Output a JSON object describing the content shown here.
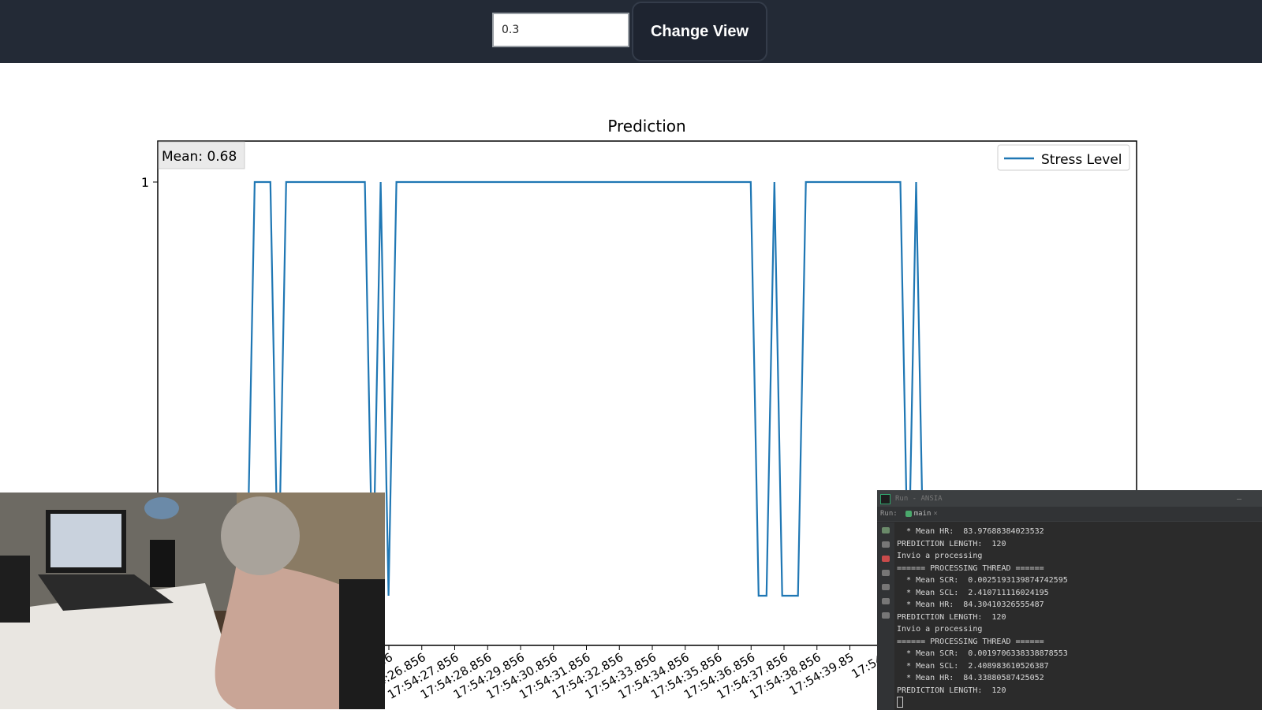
{
  "toolbar": {
    "threshold_value": "0.3",
    "change_view_label": "Change View"
  },
  "chart_data": {
    "type": "line",
    "title": "Prediction",
    "annotation": "Mean: 0.68",
    "legend": {
      "placement": "top-right",
      "entries": [
        "Stress Level"
      ]
    },
    "series": [
      {
        "name": "Stress Level",
        "color": "#1f77b4",
        "x": [
          0.0,
          0.2,
          0.4,
          0.6,
          0.8,
          1.0,
          1.2,
          1.4,
          1.6,
          1.8,
          2.0,
          2.2,
          2.4,
          2.6,
          2.8,
          3.0,
          3.2,
          3.4,
          3.6,
          3.8,
          4.0,
          4.2,
          4.4,
          4.6,
          4.8,
          5.0,
          5.2,
          5.4,
          5.6,
          5.8,
          6.0,
          6.2,
          6.4,
          6.6,
          6.8,
          7.0,
          7.2,
          7.4,
          7.6,
          7.8,
          8.0,
          8.2,
          8.4,
          8.6,
          8.8,
          9.0,
          9.2,
          9.4,
          9.6,
          9.8,
          10.0,
          10.2,
          10.4,
          10.6,
          10.8,
          11.0,
          11.2,
          11.4,
          11.6,
          11.8,
          12.0,
          12.2,
          12.4,
          12.6,
          12.8,
          13.0,
          13.2,
          13.4,
          13.6,
          13.8,
          14.0,
          14.2,
          14.4,
          14.6,
          14.8,
          15.0,
          15.2,
          15.4,
          15.6,
          15.8,
          16.0,
          16.2,
          16.4,
          16.6,
          16.8,
          17.0,
          17.2,
          17.4,
          17.6,
          17.8,
          18.0,
          18.2,
          18.4,
          18.6,
          18.8,
          19.0,
          19.2,
          19.4,
          19.6,
          19.8,
          20.0,
          20.2,
          20.4,
          20.6,
          20.8,
          21.0,
          21.2,
          21.4,
          21.6,
          21.8,
          22.0,
          22.2,
          22.4,
          22.6,
          22.8,
          23.0,
          23.2,
          23.4,
          23.6,
          23.8
        ],
        "y": [
          0,
          0,
          0,
          0,
          0,
          0,
          0,
          0,
          1,
          1,
          1,
          0,
          1,
          1,
          1,
          1,
          1,
          1,
          1,
          1,
          1,
          1,
          1,
          0,
          1,
          0,
          1,
          1,
          1,
          1,
          1,
          1,
          1,
          1,
          1,
          1,
          1,
          1,
          1,
          1,
          1,
          1,
          1,
          1,
          1,
          1,
          1,
          1,
          1,
          1,
          1,
          1,
          1,
          1,
          1,
          1,
          1,
          1,
          1,
          1,
          1,
          1,
          1,
          1,
          1,
          1,
          1,
          1,
          1,
          1,
          1,
          1,
          0,
          0,
          1,
          0,
          0,
          0,
          1,
          1,
          1,
          1,
          1,
          1,
          1,
          1,
          1,
          1,
          1,
          1,
          1,
          0,
          1,
          0,
          0,
          0,
          0,
          0,
          0,
          0,
          0,
          0,
          0,
          0,
          0,
          0,
          0,
          0,
          0,
          0,
          0,
          0,
          0,
          0,
          0,
          0,
          0,
          0,
          0,
          0
        ]
      }
    ],
    "yticks": [
      "1"
    ],
    "xtick_labels": [
      "25.856",
      "17:54:26.856",
      "17:54:27.856",
      "17:54:28.856",
      "17:54:29.856",
      "17:54:30.856",
      "17:54:31.856",
      "17:54:32.856",
      "17:54:33.856",
      "17:54:34.856",
      "17:54:35.856",
      "17:54:36.856",
      "17:54:37.856",
      "17:54:38.856",
      "17:54:39.85",
      "17:54:"
    ],
    "ylim": [
      0,
      1.1
    ],
    "grid": false
  },
  "terminal": {
    "title": "Run - ANSIA",
    "run_label": "Run:",
    "tab_label": "main",
    "lines": [
      "  * Mean HR:  83.97688384023532",
      "PREDICTION LENGTH:  120",
      "Invio a processing",
      "====== PROCESSING THREAD ======",
      "  * Mean SCR:  0.0025193139874742595",
      "  * Mean SCL:  2.410711116024195",
      "  * Mean HR:  84.30410326555487",
      "PREDICTION LENGTH:  120",
      "Invio a processing",
      "====== PROCESSING THREAD ======",
      "  * Mean SCR:  0.0019706338338878553",
      "  * Mean SCL:  2.408983610526387",
      "  * Mean HR:  84.33880587425052",
      "PREDICTION LENGTH:  120"
    ]
  }
}
